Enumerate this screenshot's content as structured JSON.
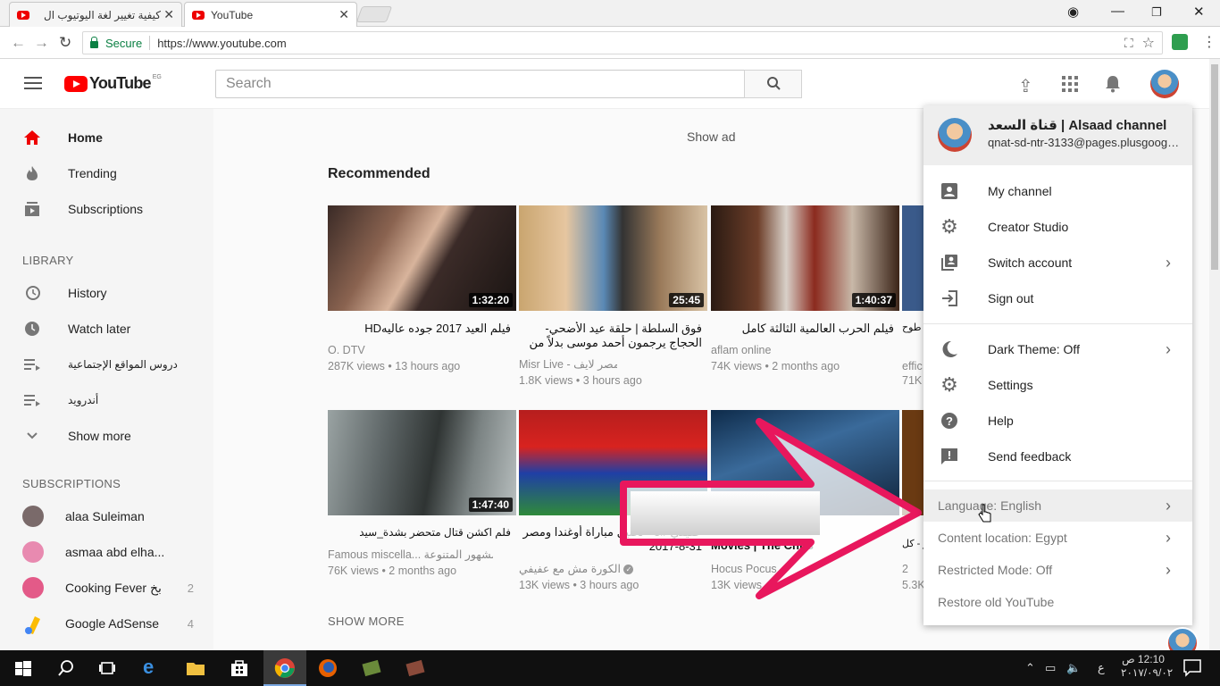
{
  "browser": {
    "tabs": [
      {
        "title": "كيفية تغيير لغة اليوتيوب ال",
        "active": false
      },
      {
        "title": "YouTube",
        "active": true
      }
    ],
    "secure_label": "Secure",
    "url": "https://www.youtube.com"
  },
  "header": {
    "logo_text": "YouTube",
    "country_code": "EG",
    "search_placeholder": "Search"
  },
  "sidebar": {
    "main": [
      {
        "label": "Home",
        "icon": "home-icon",
        "active": true
      },
      {
        "label": "Trending",
        "icon": "flame-icon"
      },
      {
        "label": "Subscriptions",
        "icon": "subscriptions-icon"
      }
    ],
    "library_heading": "LIBRARY",
    "library": [
      {
        "label": "History",
        "icon": "history-icon"
      },
      {
        "label": "Watch later",
        "icon": "clock-icon"
      },
      {
        "label": "دروس المواقع الإجتماعية",
        "icon": "playlist-icon"
      },
      {
        "label": "أندرويد",
        "icon": "playlist-icon"
      },
      {
        "label": "Show more",
        "icon": "chevron-down-icon"
      }
    ],
    "subscriptions_heading": "SUBSCRIPTIONS",
    "subscriptions": [
      {
        "label": "alaa Suleiman",
        "count": "",
        "color": "#7a6a6a"
      },
      {
        "label": "asmaa abd elha...",
        "count": "",
        "color": "#e88ab0"
      },
      {
        "label": "Cooking Fever بخ",
        "count": "2",
        "color": "#e35a88"
      },
      {
        "label": "Google AdSense",
        "count": "4",
        "color": "#fbbc04"
      }
    ]
  },
  "main": {
    "show_ad": "Show ad",
    "recommended": "Recommended",
    "show_more": "SHOW MORE",
    "videos_row1": [
      {
        "title": "فيلم العيد 2017 جوده عاليهHD",
        "channel": "O. DTV",
        "views": "287K views • 13 hours ago",
        "duration": "1:32:20"
      },
      {
        "title": "فوق السلطة | حلقة عيد الأضحي- الحجاج يرجمون أحمد موسى بدلاً من إبليس",
        "channel": "Misr Live - مصر لايف",
        "views": "1.8K views • 3 hours ago",
        "duration": "25:45"
      },
      {
        "title": "فيلم الحرب العالمية الثالثة كامل",
        "channel": "aflam online",
        "views": "74K views • 2 months ago",
        "duration": "1:40:37"
      },
      {
        "title": "سبن بن طوح",
        "channel": "effic",
        "views": "71K",
        "duration": ""
      }
    ],
    "videos_row2": [
      {
        "title": "فلم اكشن قتال متحضر بشدة_سيد السيف",
        "channel": "Famous miscella... مشهور المتنوعة",
        "views": "76K views • 2 months ago",
        "duration": "1:47:40"
      },
      {
        "title": "عفيفي #5 - تحليل مباراة أوغندا ومصر 31-8-2017",
        "channel": "الكورة مش مع عفيفي",
        "views": "13K views • 3 hours ago",
        "duration": ""
      },
      {
        "title": "Movies | The Chris",
        "channel": "Hocus Pocus",
        "views": "13K views",
        "duration": ""
      },
      {
        "title": "سر - كل",
        "channel": "2",
        "views": "5.3K",
        "duration": ""
      }
    ]
  },
  "account_menu": {
    "name": "قناة السعد | Alsaad channel",
    "email": "qnat-sd-ntr-3133@pages.plusgoogle.com",
    "items": [
      {
        "label": "My channel",
        "icon": "account-box-icon",
        "chevron": false
      },
      {
        "label": "Creator Studio",
        "icon": "gear-icon",
        "chevron": false
      },
      {
        "label": "Switch account",
        "icon": "switch-account-icon",
        "chevron": true
      },
      {
        "label": "Sign out",
        "icon": "sign-out-icon",
        "chevron": false
      }
    ],
    "items2": [
      {
        "label": "Dark Theme: Off",
        "icon": "moon-icon",
        "chevron": true
      },
      {
        "label": "Settings",
        "icon": "gear-icon",
        "chevron": false
      },
      {
        "label": "Help",
        "icon": "help-icon",
        "chevron": false
      },
      {
        "label": "Send feedback",
        "icon": "feedback-icon",
        "chevron": false
      }
    ],
    "items3": [
      {
        "label": "Language: English",
        "chevron": true
      },
      {
        "label": "Content location: Egypt",
        "chevron": true
      },
      {
        "label": "Restricted Mode: Off",
        "chevron": true
      },
      {
        "label": "Restore old YouTube",
        "chevron": false
      }
    ]
  },
  "taskbar": {
    "time": "12:10 ص",
    "date": "٢٠١٧/٠٩/٠٢",
    "lang": "ع"
  },
  "colors": {
    "youtube_red": "#ff0000",
    "arrow_pink": "#e8175d",
    "secure_green": "#0b8043"
  }
}
